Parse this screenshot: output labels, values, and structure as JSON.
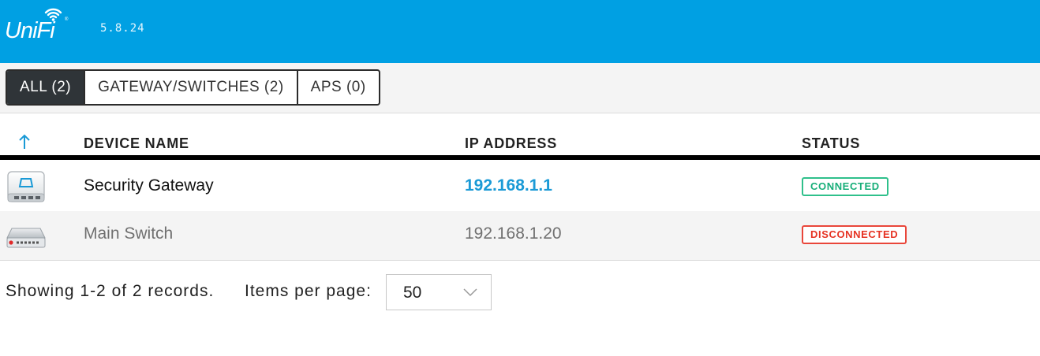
{
  "app": {
    "brand": "UniFi",
    "version": "5.8.24",
    "brand_color": "#00a0e3"
  },
  "tabs": [
    {
      "label": "ALL (2)",
      "active": true
    },
    {
      "label": "GATEWAY/SWITCHES (2)",
      "active": false
    },
    {
      "label": "APS (0)",
      "active": false
    }
  ],
  "table": {
    "sort_icon": "arrow-up-icon",
    "columns": {
      "device_name": "DEVICE NAME",
      "ip_address": "IP ADDRESS",
      "status": "STATUS"
    },
    "rows": [
      {
        "icon": "security-gateway-device-icon",
        "name": "Security Gateway",
        "ip": "192.168.1.1",
        "status": "CONNECTED",
        "status_color": "#17ae79"
      },
      {
        "icon": "switch-device-icon",
        "name": "Main Switch",
        "ip": "192.168.1.20",
        "status": "DISCONNECTED",
        "status_color": "#e63323"
      }
    ]
  },
  "pagination": {
    "records_text": "Showing 1-2 of 2 records.",
    "items_per_page_label": "Items per page:",
    "items_per_page_value": "50"
  }
}
